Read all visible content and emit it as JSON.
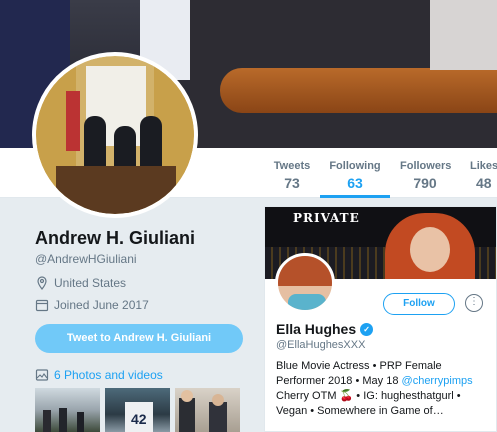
{
  "nav": {
    "items": [
      {
        "label": "Tweets",
        "value": "73"
      },
      {
        "label": "Following",
        "value": "63"
      },
      {
        "label": "Followers",
        "value": "790"
      },
      {
        "label": "Likes",
        "value": "48"
      }
    ],
    "active": "Following"
  },
  "profile": {
    "name": "Andrew H. Giuliani",
    "handle": "@AndrewHGiuliani",
    "location": "United States",
    "joined": "Joined June 2017",
    "tweet_to_label": "Tweet to Andrew H. Giuliani",
    "photos_label": "6 Photos and videos"
  },
  "card": {
    "banner_logo": "PRIVATE",
    "follow_label": "Follow",
    "name": "Ella Hughes",
    "handle": "@EllaHughesXXX",
    "bio_part1": "Blue Movie Actress • PRP Female Performer 2018 • May 18 ",
    "bio_mention": "@cherrypimps",
    "bio_part2": " Cherry OTM 🍒 • IG: hughesthatgurl • Vegan • Somewhere in Game of…"
  },
  "icons": {
    "location": "location-pin-icon",
    "calendar": "calendar-icon",
    "photos": "image-icon",
    "verified": "verified-badge-icon",
    "more": "more-dots-icon"
  },
  "colors": {
    "accent": "#1da1f2",
    "tweet_to_button": "#71c9f8",
    "background": "#e6ecf0"
  }
}
